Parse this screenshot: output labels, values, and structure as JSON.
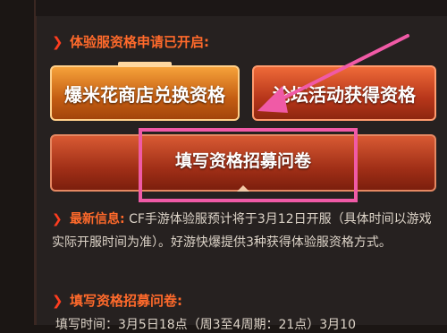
{
  "colors": {
    "accent": "#ff6a2b",
    "highlight": "#f05aa6",
    "panel": "#262120"
  },
  "section1": {
    "title": "体验服资格申请已开启:"
  },
  "buttons": {
    "popcorn": "爆米花商店兑换资格",
    "forum": "论坛活动获得资格",
    "survey": "填写资格招募问卷"
  },
  "news": {
    "label": "最新信息:",
    "text": "CF手游体验服预计将于3月12日开服（具体时间以游戏实际开服时间为准）。好游快爆提供3种获得体验服资格方式。"
  },
  "section2": {
    "title": "填写资格招募问卷:"
  },
  "bottom": {
    "text": "填写时间：3月5日18点（周3至4周期：21点）3月10"
  },
  "icons": {
    "section_marker": "chevron-right-icon",
    "annotation": "arrow-icon"
  }
}
